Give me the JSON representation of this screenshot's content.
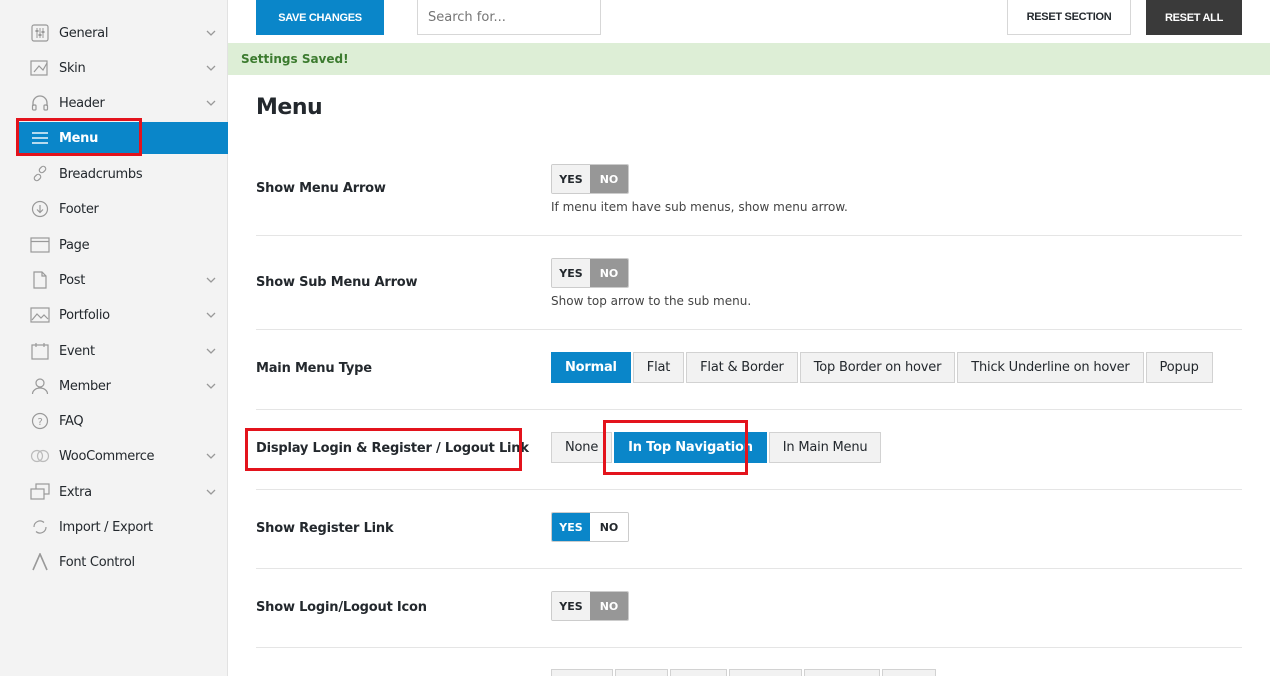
{
  "sidebar": {
    "items": [
      {
        "label": "General",
        "icon": "sliders-icon",
        "chevron": true,
        "active": false
      },
      {
        "label": "Skin",
        "icon": "paint-icon",
        "chevron": true,
        "active": false
      },
      {
        "label": "Header",
        "icon": "headphones-icon",
        "chevron": true,
        "active": false
      },
      {
        "label": "Menu",
        "icon": "hamburger-icon",
        "chevron": false,
        "active": true
      },
      {
        "label": "Breadcrumbs",
        "icon": "link-icon",
        "chevron": false,
        "active": false
      },
      {
        "label": "Footer",
        "icon": "arrow-down-circle-icon",
        "chevron": false,
        "active": false
      },
      {
        "label": "Page",
        "icon": "page-icon",
        "chevron": false,
        "active": false
      },
      {
        "label": "Post",
        "icon": "document-icon",
        "chevron": true,
        "active": false
      },
      {
        "label": "Portfolio",
        "icon": "image-icon",
        "chevron": true,
        "active": false
      },
      {
        "label": "Event",
        "icon": "calendar-icon",
        "chevron": true,
        "active": false
      },
      {
        "label": "Member",
        "icon": "user-icon",
        "chevron": true,
        "active": false
      },
      {
        "label": "FAQ",
        "icon": "question-icon",
        "chevron": false,
        "active": false
      },
      {
        "label": "WooCommerce",
        "icon": "woocommerce-icon",
        "chevron": true,
        "active": false
      },
      {
        "label": "Extra",
        "icon": "layers-icon",
        "chevron": true,
        "active": false
      },
      {
        "label": "Import / Export",
        "icon": "sync-icon",
        "chevron": false,
        "active": false
      },
      {
        "label": "Font Control",
        "icon": "font-icon",
        "chevron": false,
        "active": false
      }
    ]
  },
  "toolbar": {
    "save_label": "SAVE CHANGES",
    "search_placeholder": "Search for...",
    "reset_section_label": "RESET SECTION",
    "reset_all_label": "RESET ALL"
  },
  "notice": "Settings Saved!",
  "page_title": "Menu",
  "settings": {
    "show_menu_arrow": {
      "label": "Show Menu Arrow",
      "yes": "YES",
      "no": "NO",
      "value": "NO",
      "desc": "If menu item have sub menus, show menu arrow."
    },
    "show_sub_menu_arrow": {
      "label": "Show Sub Menu Arrow",
      "yes": "YES",
      "no": "NO",
      "value": "NO",
      "desc": "Show top arrow to the sub menu."
    },
    "main_menu_type": {
      "label": "Main Menu Type",
      "options": [
        "Normal",
        "Flat",
        "Flat & Border",
        "Top Border on hover",
        "Thick Underline on hover",
        "Popup"
      ],
      "selected": "Normal"
    },
    "display_login": {
      "label": "Display Login & Register / Logout Link",
      "options": [
        "None",
        "In Top Navigation",
        "In Main Menu"
      ],
      "selected": "In Top Navigation"
    },
    "show_register_link": {
      "label": "Show Register Link",
      "yes": "YES",
      "no": "NO",
      "value": "YES"
    },
    "show_login_icon": {
      "label": "Show Login/Logout Icon",
      "yes": "YES",
      "no": "NO",
      "value": "NO"
    }
  },
  "colors": {
    "accent": "#0a86c9",
    "highlight": "#e3131c",
    "notice_bg": "#ddeed6",
    "notice_text": "#3c7b2f"
  }
}
